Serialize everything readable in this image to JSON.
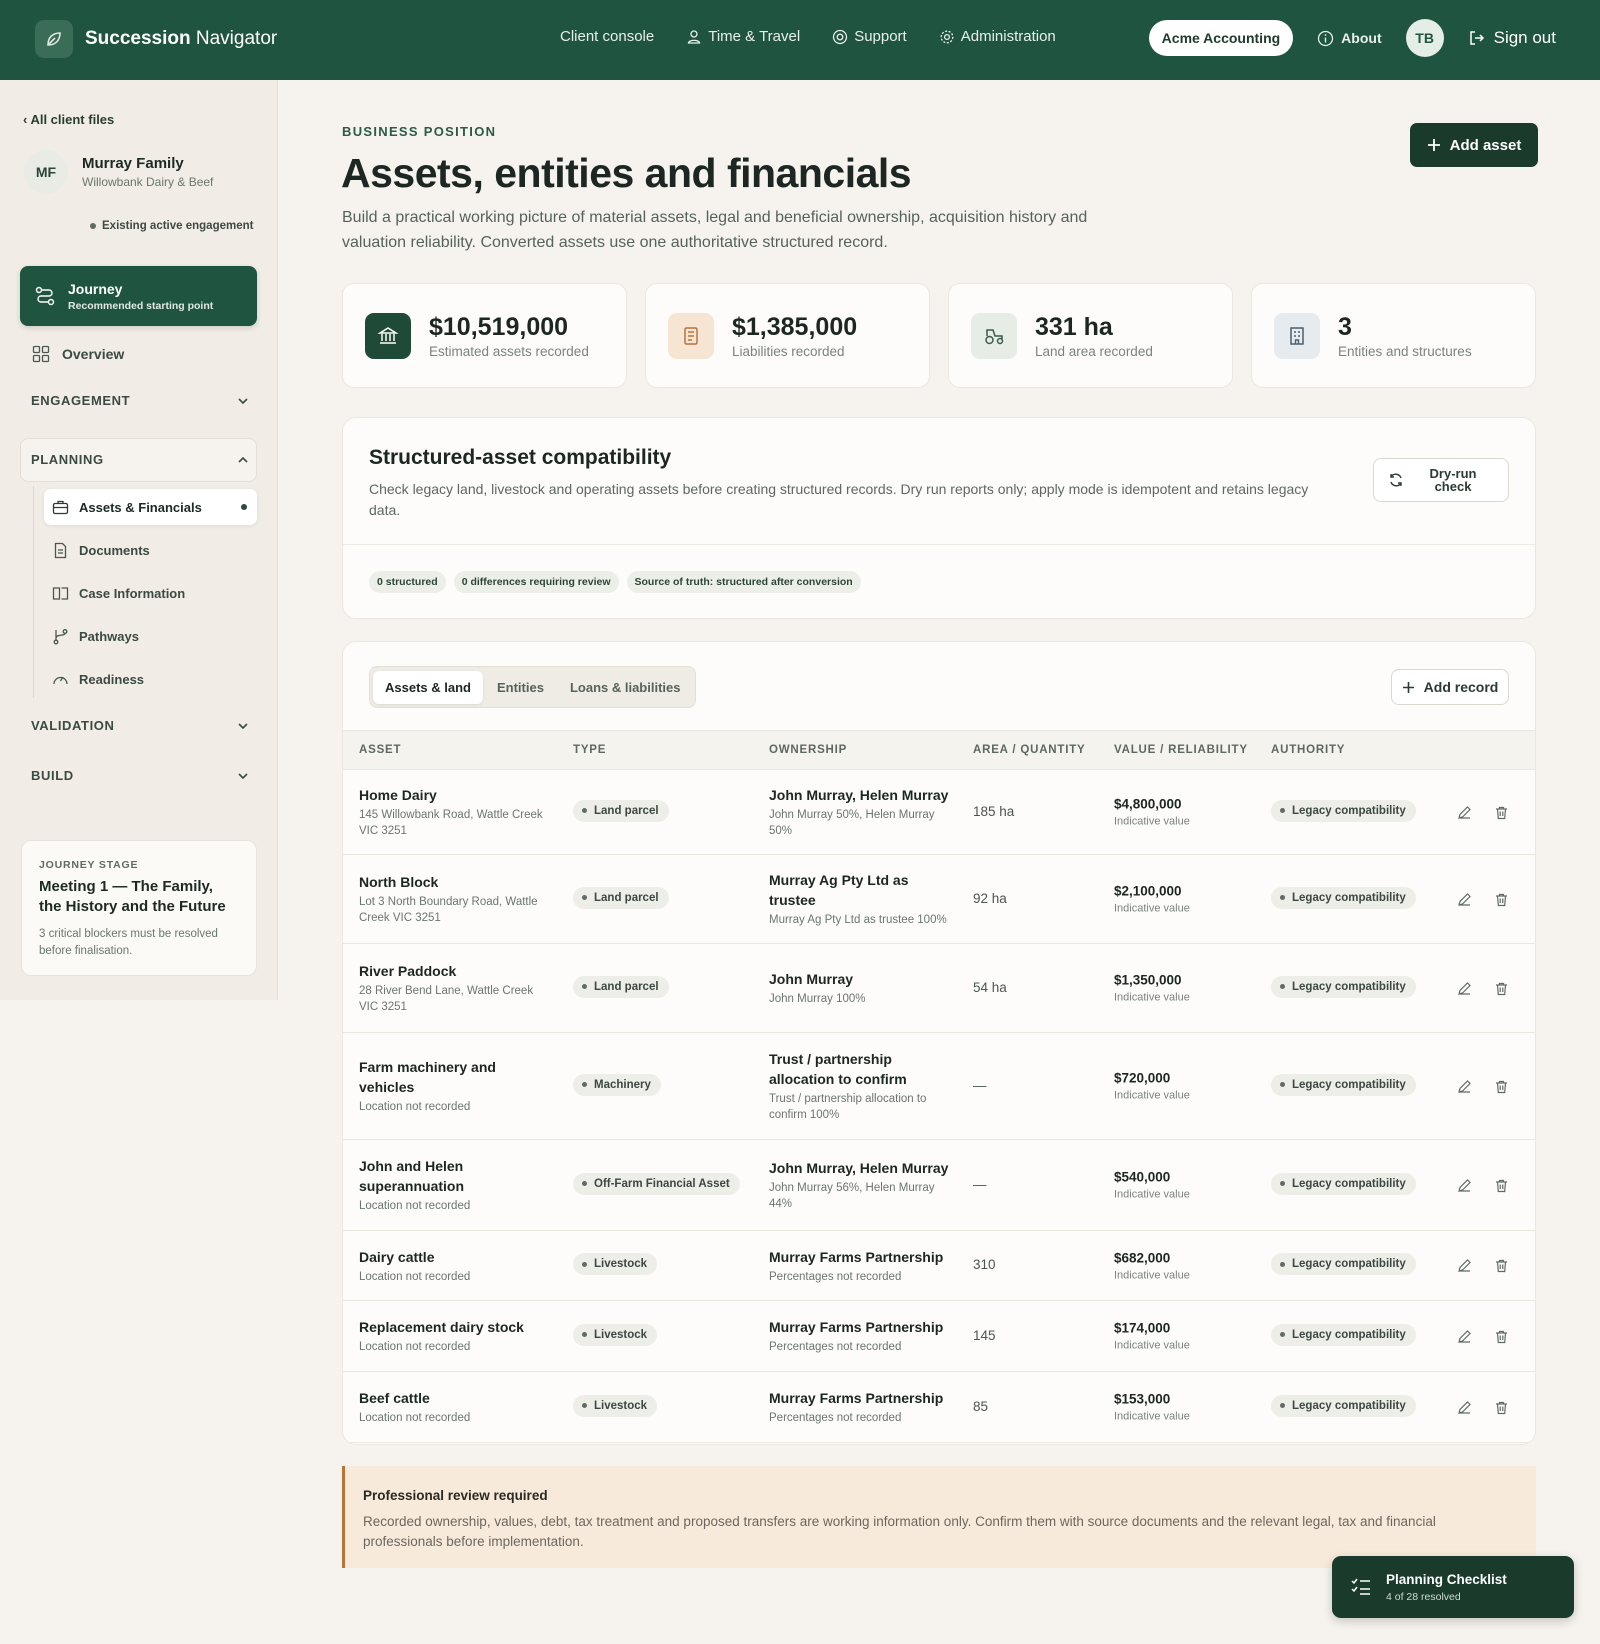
{
  "header": {
    "brand_bold": "Succession",
    "brand_light": "Navigator",
    "nav": [
      "Client console",
      "Time & Travel",
      "Support",
      "Administration"
    ],
    "org": "Acme Accounting",
    "about": "About",
    "user_initials": "TB",
    "sign_out": "Sign out"
  },
  "sidebar": {
    "back": "‹ All client files",
    "client_initials": "MF",
    "client_name": "Murray Family",
    "client_sub": "Willowbank Dairy & Beef",
    "engagement_status": "Existing active engagement",
    "journey_title": "Journey",
    "journey_sub": "Recommended starting point",
    "overview": "Overview",
    "sections": {
      "engagement": "ENGAGEMENT",
      "planning": "PLANNING",
      "validation": "VALIDATION",
      "build": "BUILD"
    },
    "planning_items": [
      "Assets & Financials",
      "Documents",
      "Case Information",
      "Pathways",
      "Readiness"
    ],
    "stage_label": "JOURNEY STAGE",
    "stage_title": "Meeting 1 — The Family, the History and the Future",
    "stage_note": "3 critical blockers must be resolved before finalisation."
  },
  "page": {
    "eyebrow": "BUSINESS POSITION",
    "title": "Assets, entities and financials",
    "description": "Build a practical working picture of material assets, legal and beneficial ownership, acquisition history and valuation reliability. Converted assets use one authoritative structured record.",
    "add_asset": "Add asset"
  },
  "stats": [
    {
      "value": "$10,519,000",
      "label": "Estimated assets recorded",
      "icon": "bank-icon",
      "bg": "#1f4a37",
      "fg": "#ffffff"
    },
    {
      "value": "$1,385,000",
      "label": "Liabilities recorded",
      "icon": "ledger-icon",
      "bg": "#f6e5d2",
      "fg": "#b9733a"
    },
    {
      "value": "331 ha",
      "label": "Land area recorded",
      "icon": "tractor-icon",
      "bg": "#e6ece6",
      "fg": "#3c5a4a"
    },
    {
      "value": "3",
      "label": "Entities and structures",
      "icon": "building-icon",
      "bg": "#e6ebef",
      "fg": "#4a5f6e"
    }
  ],
  "compat": {
    "title": "Structured-asset compatibility",
    "description": "Check legacy land, livestock and operating assets before creating structured records. Dry run reports only; apply mode is idempotent and retains legacy data.",
    "dry_run_l1": "Dry-run",
    "dry_run_l2": "check",
    "chips": [
      "0 structured",
      "0 differences requiring review",
      "Source of truth: structured after conversion"
    ]
  },
  "table": {
    "tabs": [
      "Assets & land",
      "Entities",
      "Loans & liabilities"
    ],
    "add_record": "Add record",
    "headers": [
      "ASSET",
      "TYPE",
      "OWNERSHIP",
      "AREA / QUANTITY",
      "VALUE / RELIABILITY",
      "AUTHORITY"
    ],
    "rows": [
      {
        "name": "Home Dairy",
        "sub": "145 Willowbank Road, Wattle Creek VIC 3251",
        "type": "Land parcel",
        "owner": "John Murray, Helen Murray",
        "owner_sub": "John Murray 50%, Helen Murray 50%",
        "qty": "185 ha",
        "value": "$4,800,000",
        "value_sub": "Indicative value",
        "authority": "Legacy compatibility"
      },
      {
        "name": "North Block",
        "sub": "Lot 3 North Boundary Road, Wattle Creek VIC 3251",
        "type": "Land parcel",
        "owner": "Murray Ag Pty Ltd as trustee",
        "owner_sub": "Murray Ag Pty Ltd as trustee 100%",
        "qty": "92 ha",
        "value": "$2,100,000",
        "value_sub": "Indicative value",
        "authority": "Legacy compatibility"
      },
      {
        "name": "River Paddock",
        "sub": "28 River Bend Lane, Wattle Creek VIC 3251",
        "type": "Land parcel",
        "owner": "John Murray",
        "owner_sub": "John Murray 100%",
        "qty": "54 ha",
        "value": "$1,350,000",
        "value_sub": "Indicative value",
        "authority": "Legacy compatibility"
      },
      {
        "name": "Farm machinery and vehicles",
        "sub": "Location not recorded",
        "type": "Machinery",
        "owner": "Trust / partnership allocation to confirm",
        "owner_sub": "Trust / partnership allocation to confirm 100%",
        "qty": "—",
        "value": "$720,000",
        "value_sub": "Indicative value",
        "authority": "Legacy compatibility"
      },
      {
        "name": "John and Helen superannuation",
        "sub": "Location not recorded",
        "type": "Off-Farm Financial Asset",
        "owner": "John Murray, Helen Murray",
        "owner_sub": "John Murray 56%, Helen Murray 44%",
        "qty": "—",
        "value": "$540,000",
        "value_sub": "Indicative value",
        "authority": "Legacy compatibility"
      },
      {
        "name": "Dairy cattle",
        "sub": "Location not recorded",
        "type": "Livestock",
        "owner": "Murray Farms Partnership",
        "owner_sub": "Percentages not recorded",
        "qty": "310",
        "value": "$682,000",
        "value_sub": "Indicative value",
        "authority": "Legacy compatibility"
      },
      {
        "name": "Replacement dairy stock",
        "sub": "Location not recorded",
        "type": "Livestock",
        "owner": "Murray Farms Partnership",
        "owner_sub": "Percentages not recorded",
        "qty": "145",
        "value": "$174,000",
        "value_sub": "Indicative value",
        "authority": "Legacy compatibility"
      },
      {
        "name": "Beef cattle",
        "sub": "Location not recorded",
        "type": "Livestock",
        "owner": "Murray Farms Partnership",
        "owner_sub": "Percentages not recorded",
        "qty": "85",
        "value": "$153,000",
        "value_sub": "Indicative value",
        "authority": "Legacy compatibility"
      }
    ]
  },
  "review": {
    "title": "Professional review required",
    "text": "Recorded ownership, values, debt, tax treatment and proposed transfers are working information only. Confirm them with source documents and the relevant legal, tax and financial professionals before implementation."
  },
  "checklist": {
    "title": "Planning Checklist",
    "sub": "4 of 28 resolved"
  }
}
